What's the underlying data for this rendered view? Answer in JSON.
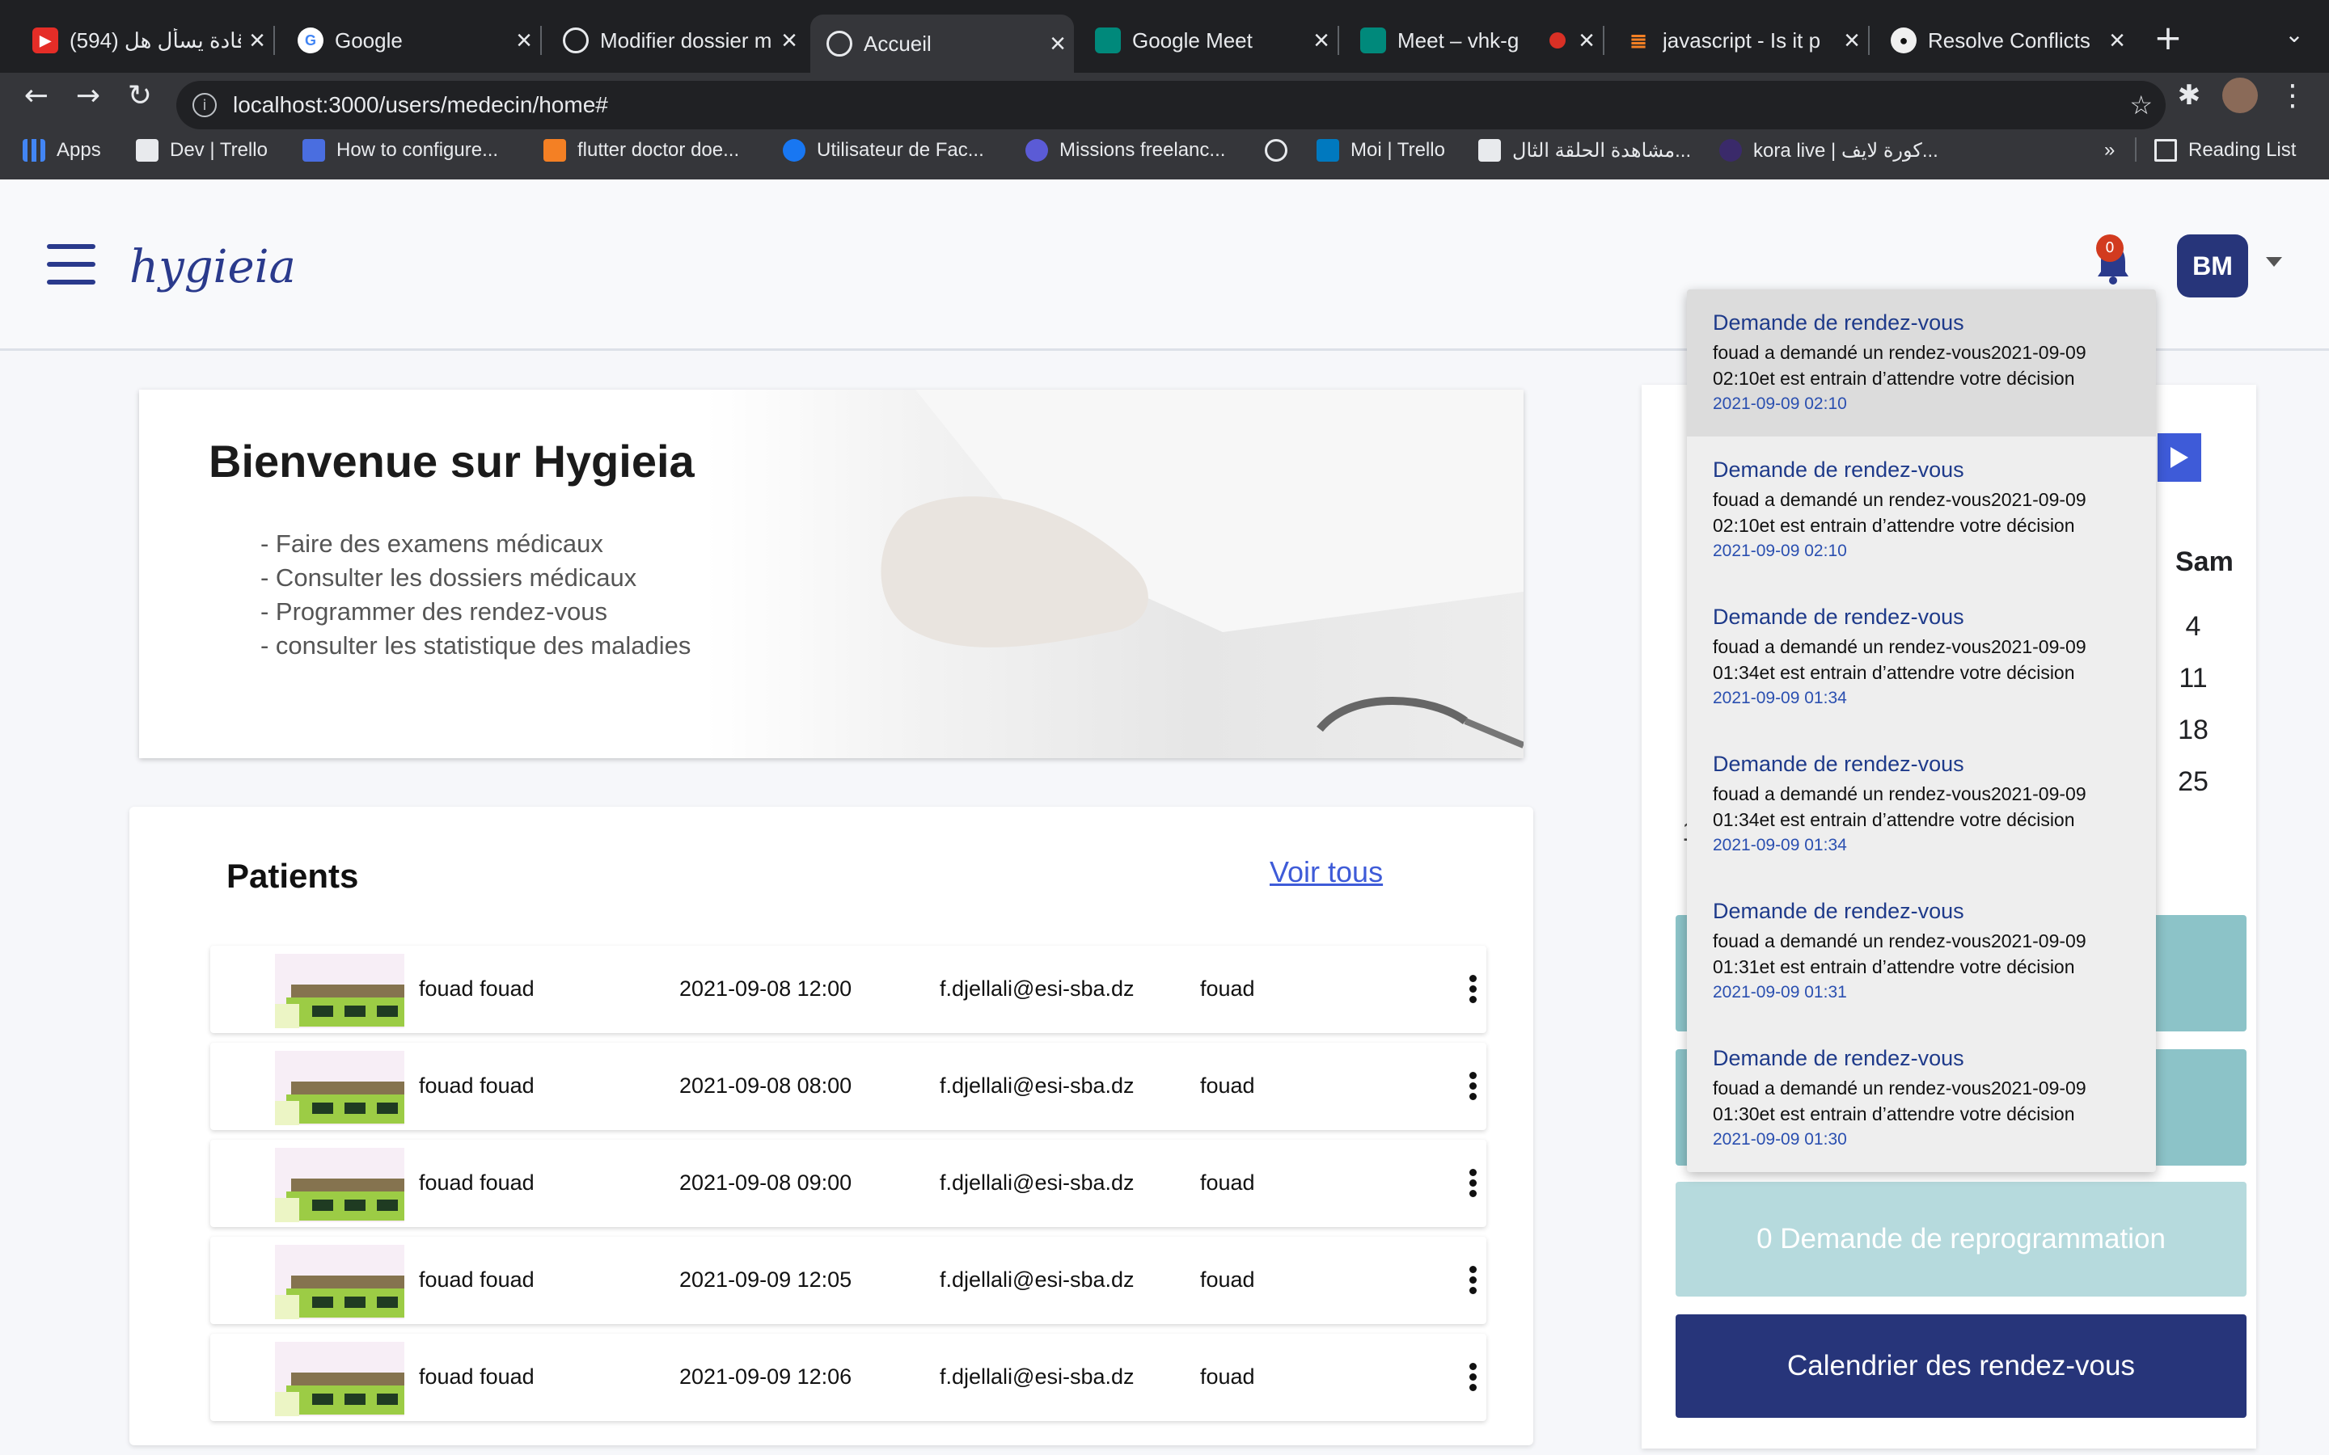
{
  "browser": {
    "tabs": [
      {
        "title": "(594) قادة يسأل هل",
        "icon": "youtube-icon",
        "color": "#e52d27",
        "active": false
      },
      {
        "title": "Google",
        "icon": "google-icon",
        "color": "#4285f4",
        "active": false
      },
      {
        "title": "Modifier dossier m",
        "icon": "globe-icon",
        "color": "#9aa0a6",
        "active": false
      },
      {
        "title": "Accueil",
        "icon": "globe-icon",
        "color": "#9aa0a6",
        "active": true
      },
      {
        "title": "Google Meet",
        "icon": "meet-icon",
        "color": "#00897b",
        "active": false
      },
      {
        "title": "Meet – vhk-g",
        "icon": "meet-icon",
        "color": "#00897b",
        "active": false
      },
      {
        "title": "javascript - Is it p",
        "icon": "stackoverflow-icon",
        "color": "#f48024",
        "active": false
      },
      {
        "title": "Resolve Conflicts",
        "icon": "github-icon",
        "color": "#f0f0f0",
        "active": false
      }
    ],
    "url": "localhost:3000/users/medecin/home#",
    "bookmarks": [
      {
        "label": "Apps",
        "icon": "apps-grid-icon",
        "color": "#4285f4"
      },
      {
        "label": "Dev | Trello",
        "icon": "doc-icon",
        "color": "#e8eaed"
      },
      {
        "label": "How to configure...",
        "icon": "cnet-icon",
        "color": "#4a6ee0"
      },
      {
        "label": "flutter doctor doe...",
        "icon": "stackoverflow-icon",
        "color": "#f48024"
      },
      {
        "label": "Utilisateur de Fac...",
        "icon": "facebook-icon",
        "color": "#1877f2"
      },
      {
        "label": "Missions freelanc...",
        "icon": "codeur-icon",
        "color": "#5b5bd6"
      },
      {
        "label": "",
        "icon": "globe-icon",
        "color": "#e8eaed"
      },
      {
        "label": "Moi | Trello",
        "icon": "trello-icon",
        "color": "#0079bf"
      },
      {
        "label": "مشاهدة الحلقة الثال...",
        "icon": "site-icon",
        "color": "#e8eaed"
      },
      {
        "label": "kora live | كورة لايف...",
        "icon": "kora-icon",
        "color": "#3a2a6a"
      }
    ],
    "reading_list": "Reading List",
    "more": "»"
  },
  "app": {
    "logo": "hygieia",
    "notification_count": "0",
    "user_initials": "BM"
  },
  "welcome": {
    "title": "Bienvenue sur Hygieia",
    "items": [
      "- Faire des examens médicaux",
      "- Consulter les dossiers médicaux",
      "- Programmer des rendez-vous",
      "- consulter les statistique des maladies"
    ]
  },
  "patients": {
    "title": "Patients",
    "see_all": "Voir tous",
    "rows": [
      {
        "name": "fouad fouad",
        "datetime": "2021-09-08 12:00",
        "email": "f.djellali@esi-sba.dz",
        "username": "fouad"
      },
      {
        "name": "fouad fouad",
        "datetime": "2021-09-08 08:00",
        "email": "f.djellali@esi-sba.dz",
        "username": "fouad"
      },
      {
        "name": "fouad fouad",
        "datetime": "2021-09-08 09:00",
        "email": "f.djellali@esi-sba.dz",
        "username": "fouad"
      },
      {
        "name": "fouad fouad",
        "datetime": "2021-09-09 12:05",
        "email": "f.djellali@esi-sba.dz",
        "username": "fouad"
      },
      {
        "name": "fouad fouad",
        "datetime": "2021-09-09 12:06",
        "email": "f.djellali@esi-sba.dz",
        "username": "fouad"
      }
    ]
  },
  "calendar": {
    "day_header": "Sam",
    "dates": [
      "4",
      "11",
      "18",
      "25"
    ],
    "partial_text": "1"
  },
  "actions": {
    "reprogram": "0 Demande de reprogrammation",
    "calendar": "Calendrier des rendez-vous"
  },
  "notifications": [
    {
      "title": "Demande de rendez-vous",
      "body": "fouad a demandé un rendez-vous2021-09-09 02:10et est entrain d’attendre votre décision",
      "date": "2021-09-09 02:10",
      "highlighted": true
    },
    {
      "title": "Demande de rendez-vous",
      "body": "fouad a demandé un rendez-vous2021-09-09 02:10et est entrain d’attendre votre décision",
      "date": "2021-09-09 02:10",
      "highlighted": false
    },
    {
      "title": "Demande de rendez-vous",
      "body": "fouad a demandé un rendez-vous2021-09-09 01:34et est entrain d’attendre votre décision",
      "date": "2021-09-09 01:34",
      "highlighted": false
    },
    {
      "title": "Demande de rendez-vous",
      "body": "fouad a demandé un rendez-vous2021-09-09 01:34et est entrain d’attendre votre décision",
      "date": "2021-09-09 01:34",
      "highlighted": false
    },
    {
      "title": "Demande de rendez-vous",
      "body": "fouad a demandé un rendez-vous2021-09-09 01:31et est entrain d’attendre votre décision",
      "date": "2021-09-09 01:31",
      "highlighted": false
    },
    {
      "title": "Demande de rendez-vous",
      "body": "fouad a demandé un rendez-vous2021-09-09 01:30et est entrain d’attendre votre décision",
      "date": "2021-09-09 01:30",
      "highlighted": false
    }
  ],
  "colors": {
    "primary": "#27357a",
    "accent": "#3e5bd8",
    "teal": "#8cc3c8",
    "badge": "#d23b1f"
  }
}
